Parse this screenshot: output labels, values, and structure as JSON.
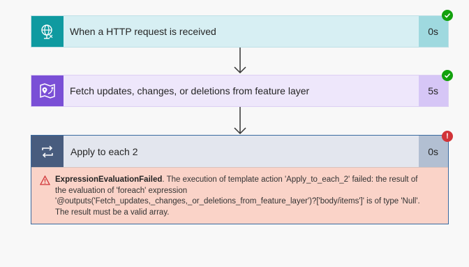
{
  "steps": [
    {
      "title": "When a HTTP request is received",
      "duration": "0s",
      "status": "success",
      "icon": "globe-icon"
    },
    {
      "title": "Fetch updates, changes, or deletions from feature layer",
      "duration": "5s",
      "status": "success",
      "icon": "map-pin-icon"
    },
    {
      "title": "Apply to each 2",
      "duration": "0s",
      "status": "failed",
      "icon": "loop-icon"
    }
  ],
  "error": {
    "code": "ExpressionEvaluationFailed",
    "message": ". The execution of template action 'Apply_to_each_2' failed: the result of the evaluation of 'foreach' expression '@outputs('Fetch_updates,_changes,_or_deletions_from_feature_layer')?['body/items']' is of type 'Null'. The result must be a valid array."
  },
  "badges": {
    "success": "✓",
    "failed": "!"
  },
  "colors": {
    "success": "#13a10e",
    "failed": "#d13438",
    "http": "#0f9aa0",
    "feature": "#7a4fd6",
    "loop": "#485c7e"
  }
}
